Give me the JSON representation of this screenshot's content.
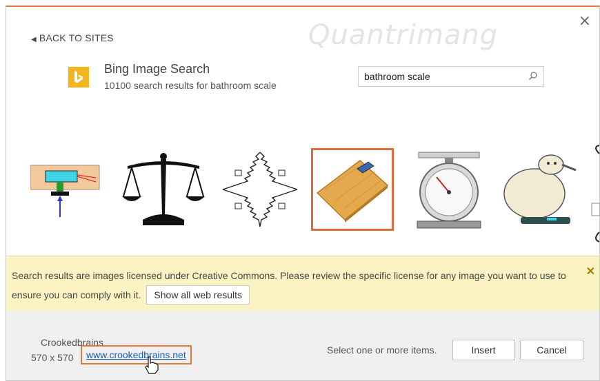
{
  "dialog": {
    "back_label": "BACK TO SITES",
    "close_label": "×"
  },
  "watermark": "Quantrimang",
  "provider": {
    "name": "Bing Image Search",
    "results_summary": "10100 search results for bathroom scale"
  },
  "search": {
    "value": "bathroom scale"
  },
  "results": [
    {
      "id": "circuit-diagram"
    },
    {
      "id": "balance-scale-icon"
    },
    {
      "id": "wheatstone-bridge-diagram"
    },
    {
      "id": "bamboo-bathroom-scale",
      "selected": true
    },
    {
      "id": "kitchen-dial-scale"
    },
    {
      "id": "sheep-on-scale-cartoon"
    }
  ],
  "banner": {
    "text_before": "Search results are images licensed under Creative Commons. Please review the specific license for any image you want to use to ensure you can comply with it.",
    "show_all_label": "Show all web results",
    "close_label": "✕"
  },
  "attribution": {
    "name": "Crookedbrains",
    "size": "570 x 570",
    "link": "www.crookedbrains.net"
  },
  "footer": {
    "select_label": "Select one or more items.",
    "insert_label": "Insert",
    "cancel_label": "Cancel"
  },
  "colors": {
    "accent": "#e07a3c",
    "bing_yellow": "#f2b51c",
    "banner_bg": "#fbf4c2",
    "link": "#1a5fb4"
  }
}
